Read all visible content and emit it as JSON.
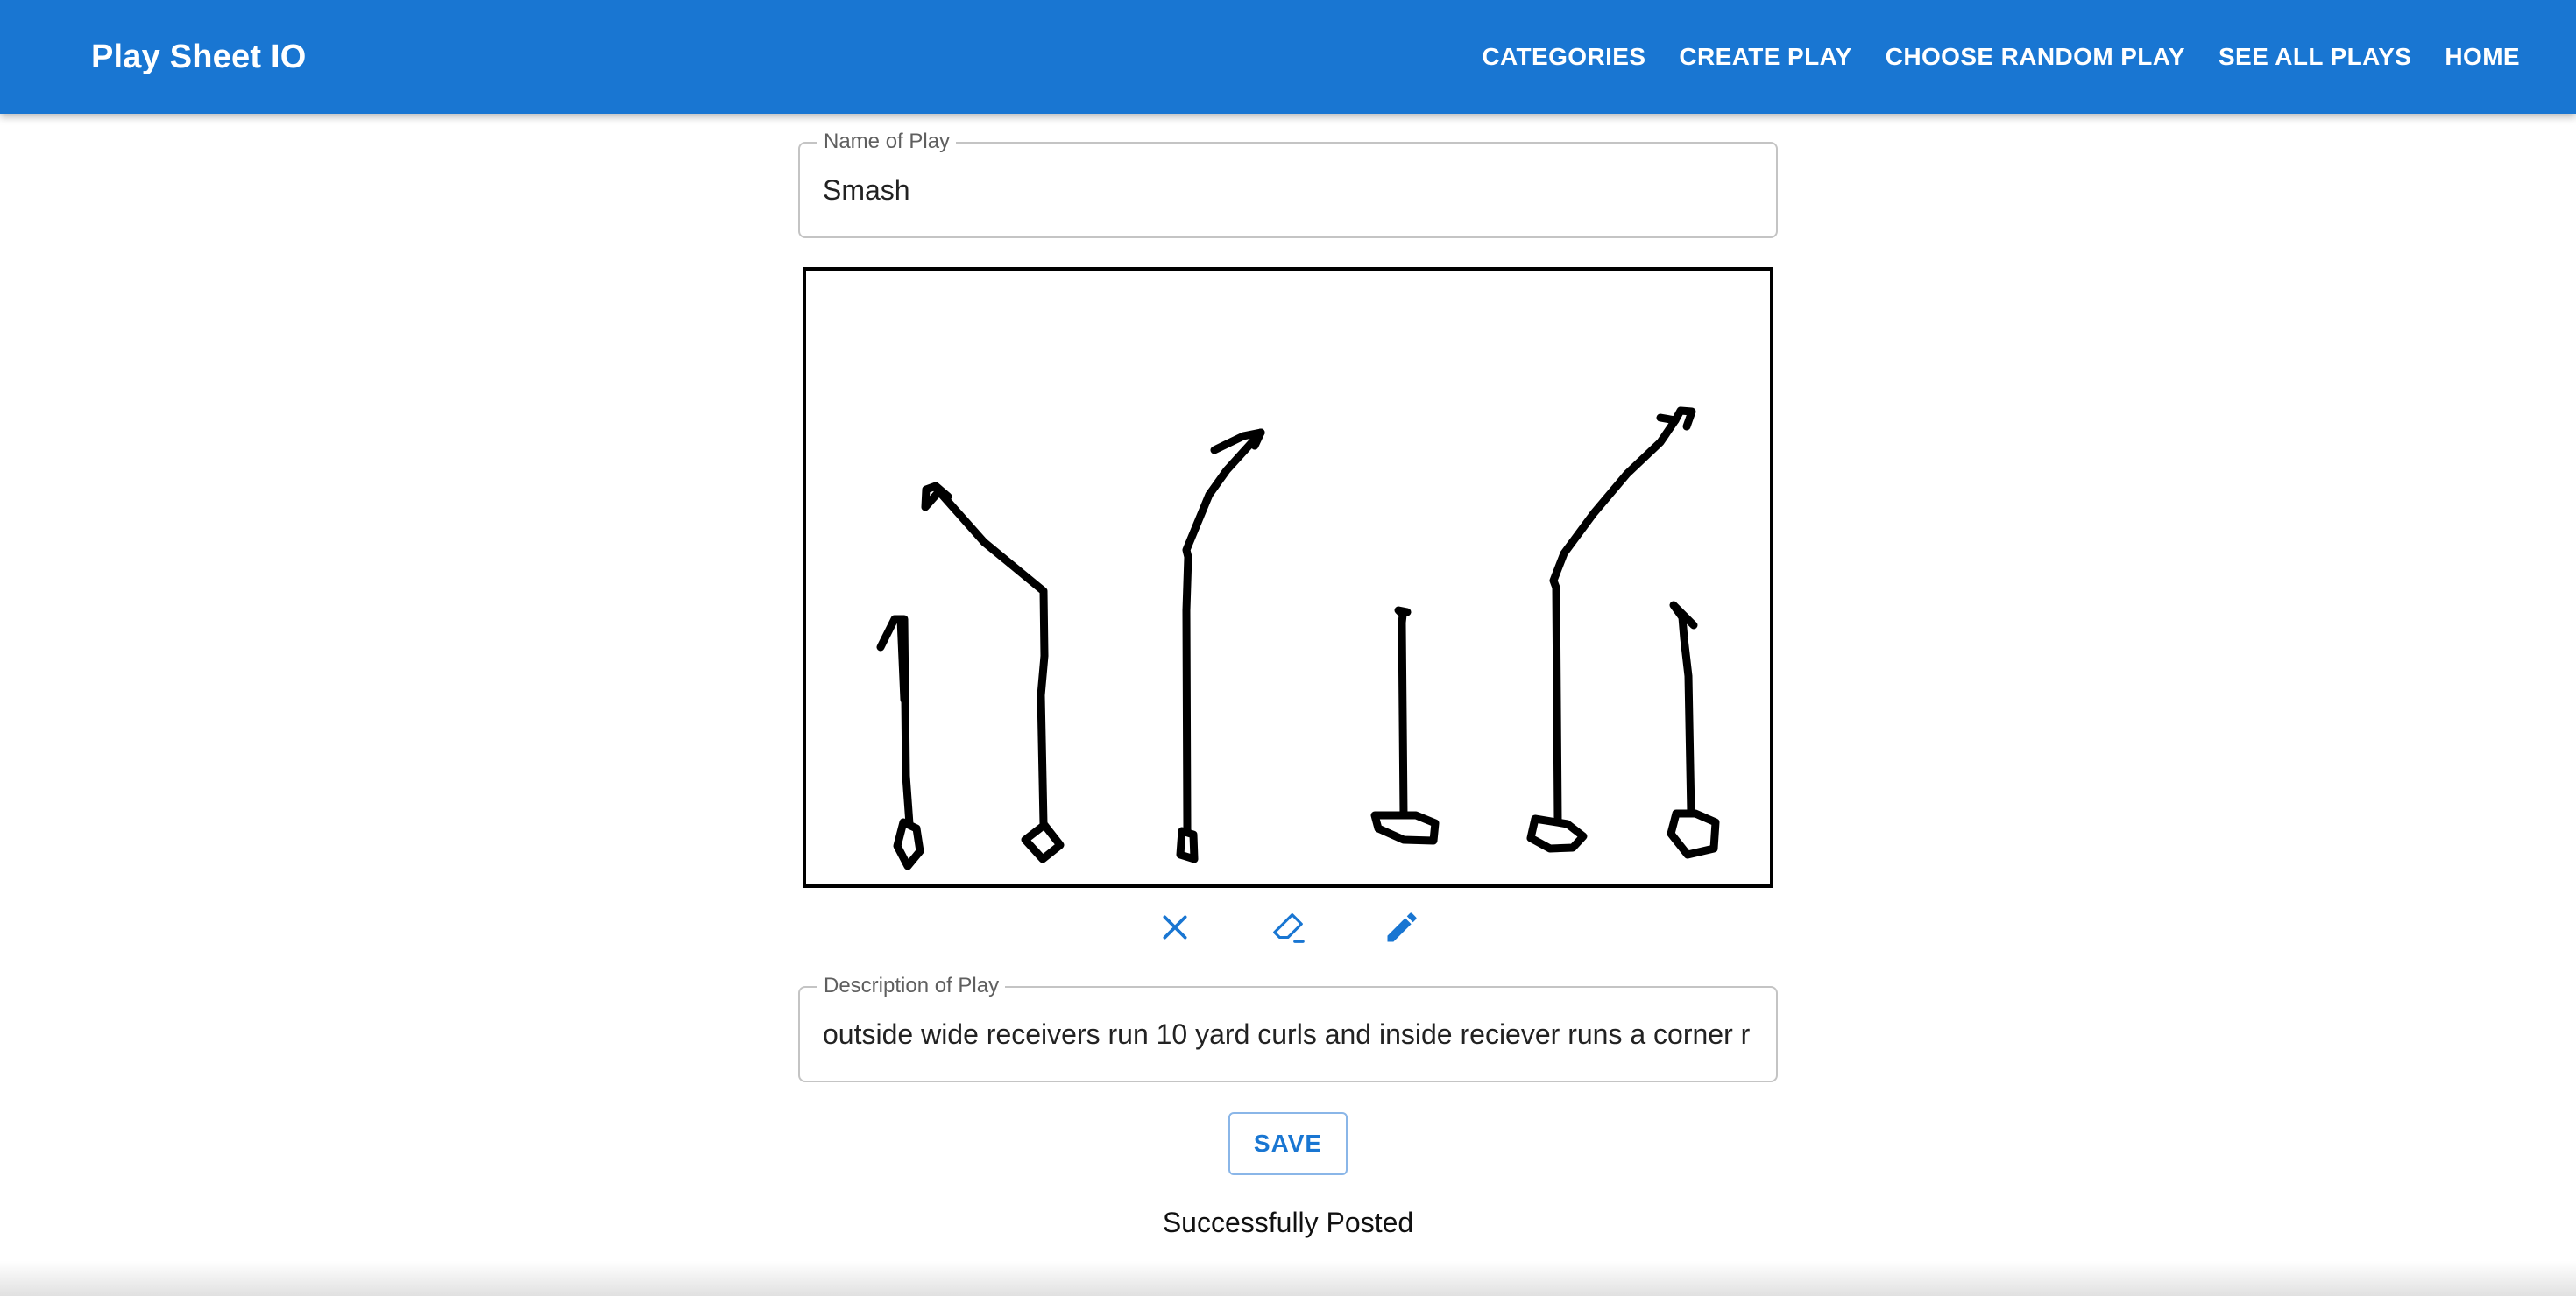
{
  "app": {
    "title": "Play Sheet IO",
    "nav": [
      {
        "label": "CATEGORIES"
      },
      {
        "label": "CREATE PLAY"
      },
      {
        "label": "CHOOSE RANDOM PLAY"
      },
      {
        "label": "SEE ALL PLAYS"
      },
      {
        "label": "HOME"
      }
    ],
    "accent_color": "#1976d2"
  },
  "form": {
    "name_label": "Name of Play",
    "name_value": "Smash",
    "description_label": "Description of Play",
    "description_value": "outside wide receivers run 10 yard curls and inside reciever runs a corner r",
    "save_label": "SAVE",
    "status": "Successfully Posted"
  },
  "tools": {
    "clear_icon": "close-icon",
    "eraser_icon": "eraser-icon",
    "pen_icon": "pencil-icon"
  }
}
